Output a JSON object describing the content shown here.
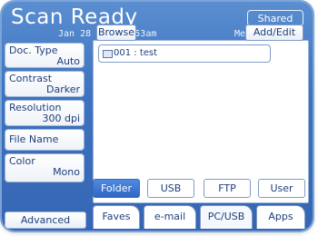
{
  "header": {
    "title": "Scan Ready",
    "shared_label": "Shared"
  },
  "status": {
    "datetime": "Jan 28 2010  4:53am",
    "memory": "Memory  100%"
  },
  "sidebar": {
    "items": [
      {
        "label": "Doc. Type",
        "value": "Auto"
      },
      {
        "label": "Contrast",
        "value": "Darker"
      },
      {
        "label": "Resolution",
        "value": "300 dpi"
      },
      {
        "label": "File Name",
        "value": ""
      },
      {
        "label": "Color",
        "value": "Mono"
      }
    ],
    "advanced_label": "Advanced"
  },
  "content": {
    "browse_label": "Browse",
    "add_edit_label": "Add/Edit",
    "folder_entry": "001 : test"
  },
  "destinations": [
    "Folder",
    "USB",
    "FTP",
    "User"
  ],
  "active_destination": "Folder",
  "tabs": [
    "Faves",
    "e-mail",
    "PC/USB",
    "Apps"
  ],
  "active_tab": "PC/USB",
  "colors": {
    "screen_blue": "#3d73c0",
    "accent_active": "#2f67c4",
    "text_blue": "#1e3f7a"
  }
}
